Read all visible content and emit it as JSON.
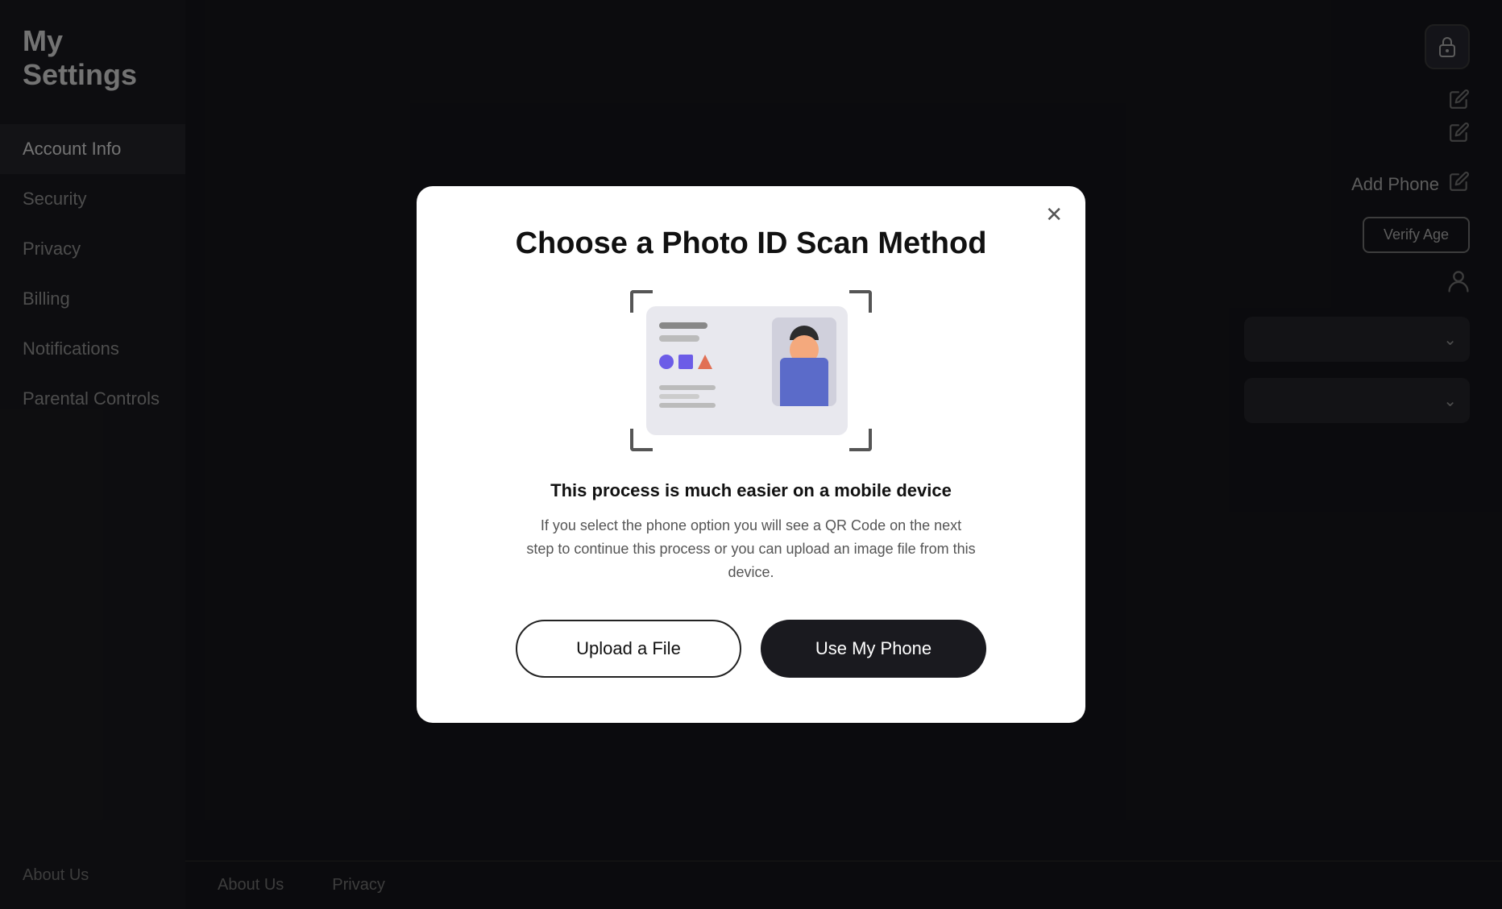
{
  "app": {
    "title": "My Settings"
  },
  "sidebar": {
    "items": [
      {
        "id": "account-info",
        "label": "Account Info",
        "active": true
      },
      {
        "id": "security",
        "label": "Security",
        "active": false
      },
      {
        "id": "privacy",
        "label": "Privacy",
        "active": false
      },
      {
        "id": "billing",
        "label": "Billing",
        "active": false
      },
      {
        "id": "notifications",
        "label": "Notifications",
        "active": false
      },
      {
        "id": "parental-controls",
        "label": "Parental Controls",
        "active": false
      }
    ],
    "footer": "About Us"
  },
  "main": {
    "add_phone": "Add Phone",
    "verify_age": "Verify Age"
  },
  "footer": {
    "links": [
      "About Us",
      "Privacy"
    ]
  },
  "modal": {
    "title": "Choose a Photo ID Scan Method",
    "subtitle": "This process is much easier on a mobile device",
    "description": "If you select the phone option you will see a QR Code on the next step to continue this process or you can upload an image file from this device.",
    "upload_btn": "Upload a File",
    "phone_btn": "Use My Phone"
  }
}
